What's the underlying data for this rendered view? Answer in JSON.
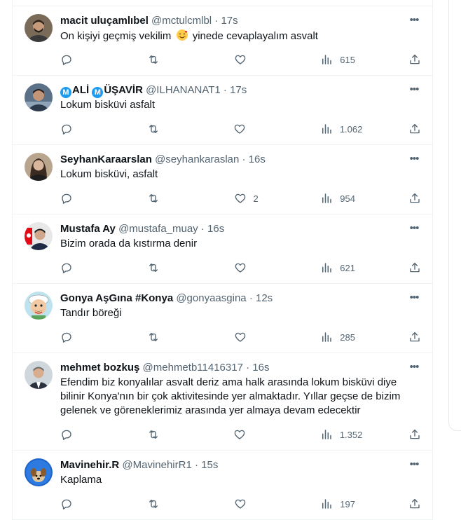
{
  "tweets": [
    {
      "name": "macit uluçamlıbel",
      "handle": "@mctulcmlbl",
      "time": "17s",
      "text_before": "On kişiyi geçmiş vekilim",
      "emoji": "smiling-face-with-hearts",
      "text_after": " yinede cevaplayalım asvalt",
      "replies": "",
      "retweets": "",
      "likes": "",
      "views": "615",
      "avatar": {
        "bg": "#7a6a58",
        "skin": "#c69a7a",
        "hair": "#2a221c",
        "shirt": "#3a3a3a"
      }
    },
    {
      "name_badge": "M",
      "name_part1": "ALİ",
      "name_part2": "ÜŞAVİR",
      "handle": "@ILHANANAT1",
      "time": "17s",
      "text": "Lokum bisküvi asfalt",
      "replies": "",
      "retweets": "",
      "likes": "",
      "views": "1.062",
      "avatar": {
        "bg": "#5b7187",
        "skin": "#c29478",
        "hair": "#241c18",
        "shirt": "#2d3a4c"
      }
    },
    {
      "name": "SeyhanKaraarslan",
      "handle": "@seyhankaraslan",
      "time": "16s",
      "text": "Lokum bisküvi, asfalt",
      "replies": "",
      "retweets": "",
      "likes": "2",
      "views": "954",
      "avatar": {
        "bg": "#b9a58d",
        "skin": "#d9b59c",
        "hair": "#3a2a20",
        "shirt": "#1e1e1e"
      }
    },
    {
      "name": "Mustafa Ay",
      "handle": "@mustafa_muay",
      "time": "16s",
      "text": "Bizim orada da kıstırma denir",
      "replies": "",
      "retweets": "",
      "likes": "",
      "views": "621",
      "avatar": {
        "bg": "#e8e8e8",
        "skin": "#d2a68a",
        "hair": "#1d1d1d",
        "shirt": "#1f2a44",
        "flag": "#e30a17"
      }
    },
    {
      "name": "Gonya AşGına #Konya",
      "handle": "@gonyaasgina",
      "time": "12s",
      "text": "Tandır böreği",
      "replies": "",
      "retweets": "",
      "likes": "",
      "views": "285",
      "avatar": {
        "bg": "#bfe3ee",
        "skin": "#f2c9a2",
        "hair": "#ffffff",
        "shirt": "#5aa35a"
      }
    },
    {
      "name": "mehmet bozkuş",
      "handle": "@mehmetb11416317",
      "time": "16s",
      "text": "Efendim biz konyalılar asvalt deriz ama halk arasında lokum bisküvi diye bilinir Konya'nın bir çok aktivitesinde yer almaktadır. Yıllar geçse de bizim gelenek ve göreneklerimiz arasında yer almaya devam edecektir",
      "replies": "",
      "retweets": "",
      "likes": "",
      "views": "1.352",
      "avatar": {
        "bg": "#cfd6dc",
        "skin": "#d8ad8f",
        "hair": "#6b6b6b",
        "shirt": "#2c3140"
      }
    },
    {
      "name": "Mavinehir.R",
      "handle": "@MavinehirR1",
      "time": "15s",
      "text": "Kaplama",
      "replies": "",
      "retweets": "",
      "likes": "",
      "views": "197",
      "avatar": {
        "bg": "#1d63c9",
        "skin": "#e0c6a0",
        "hair": "#8b5a2b",
        "shirt": "#2d7be0"
      }
    }
  ],
  "icons": {
    "reply": "reply-icon",
    "retweet": "retweet-icon",
    "like": "heart-icon",
    "views": "views-icon",
    "share": "share-icon",
    "more": "more-icon"
  },
  "colors": {
    "muted": "#536471",
    "text": "#0f1419",
    "border": "#eff3f4",
    "verified_badge": "#1d9bf0"
  }
}
